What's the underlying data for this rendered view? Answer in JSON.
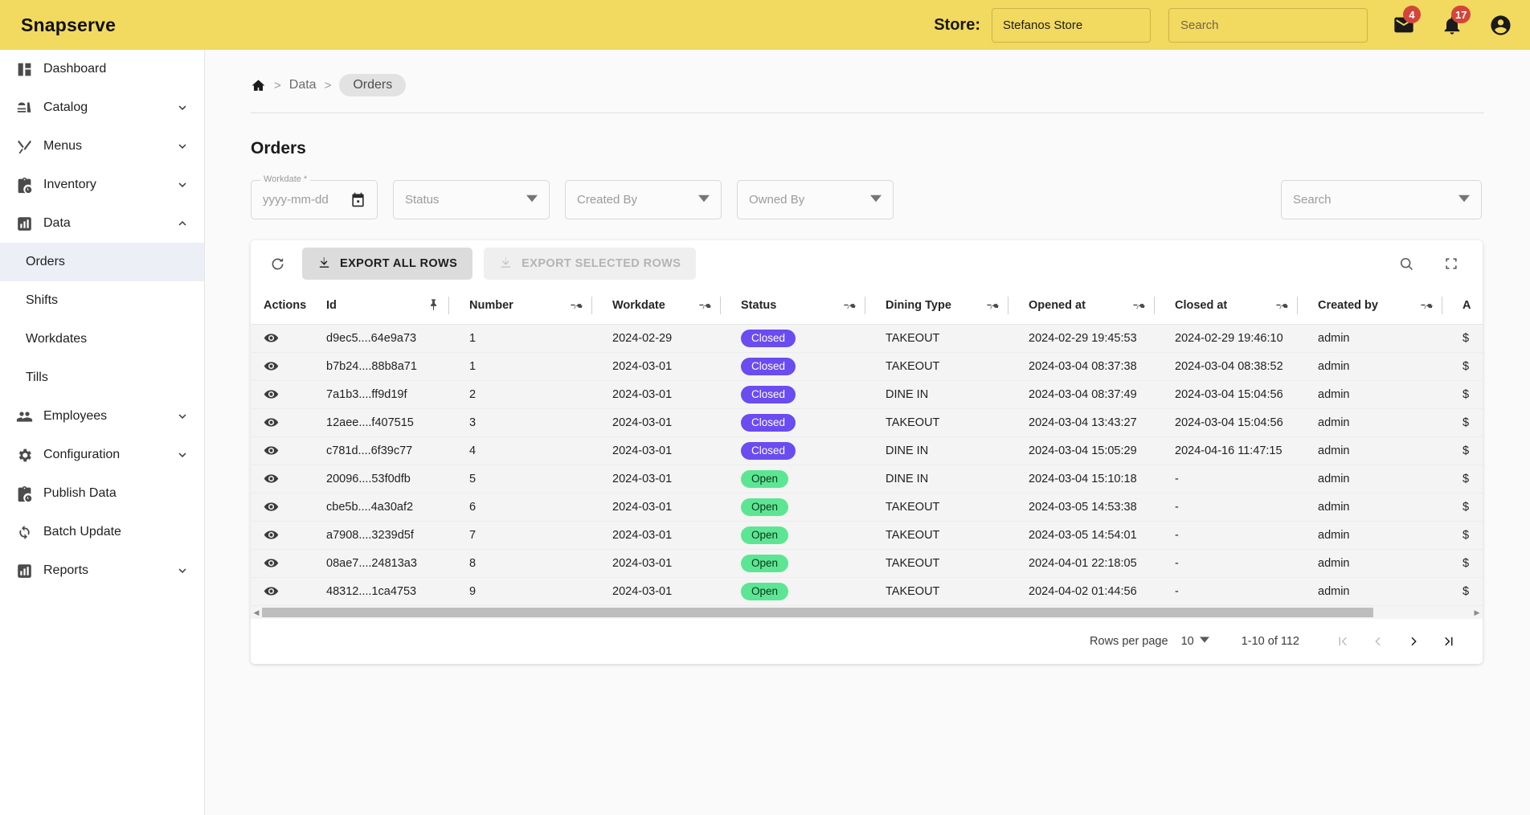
{
  "app": {
    "brand": "Snapserve",
    "header": {
      "store_label": "Store:",
      "store_value": "Stefanos Store",
      "search_placeholder": "Search",
      "mail_badge": "4",
      "bell_badge": "17",
      "accent_color": "#f2d95f"
    }
  },
  "sidebar": {
    "items": [
      {
        "label": "Dashboard",
        "icon": "dashboard-icon",
        "expandable": false
      },
      {
        "label": "Catalog",
        "icon": "catalog-icon",
        "expandable": true
      },
      {
        "label": "Menus",
        "icon": "menus-icon",
        "expandable": true
      },
      {
        "label": "Inventory",
        "icon": "inventory-icon",
        "expandable": true
      },
      {
        "label": "Data",
        "icon": "data-icon",
        "expandable": true,
        "expanded": true
      }
    ],
    "data_children": [
      {
        "label": "Orders",
        "active": true
      },
      {
        "label": "Shifts",
        "active": false
      },
      {
        "label": "Workdates",
        "active": false
      },
      {
        "label": "Tills",
        "active": false
      }
    ],
    "items_after": [
      {
        "label": "Employees",
        "icon": "employees-icon",
        "expandable": true
      },
      {
        "label": "Configuration",
        "icon": "gear-icon",
        "expandable": true
      },
      {
        "label": "Publish Data",
        "icon": "publish-icon",
        "expandable": false
      },
      {
        "label": "Batch Update",
        "icon": "sync-icon",
        "expandable": false
      },
      {
        "label": "Reports",
        "icon": "reports-icon",
        "expandable": true
      }
    ]
  },
  "breadcrumb": {
    "home_icon": "home-icon",
    "items": [
      "Data",
      "Orders"
    ],
    "separator": ">"
  },
  "page": {
    "title": "Orders"
  },
  "filters": {
    "workdate": {
      "legend": "Workdate *",
      "placeholder": "yyyy-mm-dd",
      "icon": "calendar-icon"
    },
    "status": {
      "placeholder": "Status"
    },
    "created_by": {
      "placeholder": "Created By"
    },
    "owned_by": {
      "placeholder": "Owned By"
    },
    "search": {
      "placeholder": "Search"
    }
  },
  "toolbar": {
    "refresh_icon": "refresh-icon",
    "export_all_label": "EXPORT ALL ROWS",
    "export_selected_label": "EXPORT SELECTED ROWS",
    "search_icon": "search-icon",
    "fullscreen_icon": "fullscreen-icon"
  },
  "table": {
    "columns": [
      {
        "label": "Actions",
        "pin": false
      },
      {
        "label": "Id",
        "pin": "pinned"
      },
      {
        "label": "Number",
        "pin": "unpinned"
      },
      {
        "label": "Workdate",
        "pin": "unpinned"
      },
      {
        "label": "Status",
        "pin": "unpinned"
      },
      {
        "label": "Dining Type",
        "pin": "unpinned"
      },
      {
        "label": "Opened at",
        "pin": "unpinned"
      },
      {
        "label": "Closed at",
        "pin": "unpinned"
      },
      {
        "label": "Created by",
        "pin": "unpinned"
      },
      {
        "label": "A",
        "pin": false
      }
    ],
    "rows": [
      {
        "action_icon": "eye-icon",
        "id": "d9ec5....64e9a73",
        "number": "1",
        "workdate": "2024-02-29",
        "status": "Closed",
        "dining_type": "TAKEOUT",
        "opened_at": "2024-02-29 19:45:53",
        "closed_at": "2024-02-29 19:46:10",
        "created_by": "admin",
        "amount": "$"
      },
      {
        "action_icon": "eye-icon",
        "id": "b7b24....88b8a71",
        "number": "1",
        "workdate": "2024-03-01",
        "status": "Closed",
        "dining_type": "TAKEOUT",
        "opened_at": "2024-03-04 08:37:38",
        "closed_at": "2024-03-04 08:38:52",
        "created_by": "admin",
        "amount": "$"
      },
      {
        "action_icon": "eye-icon",
        "id": "7a1b3....ff9d19f",
        "number": "2",
        "workdate": "2024-03-01",
        "status": "Closed",
        "dining_type": "DINE IN",
        "opened_at": "2024-03-04 08:37:49",
        "closed_at": "2024-03-04 15:04:56",
        "created_by": "admin",
        "amount": "$"
      },
      {
        "action_icon": "eye-icon",
        "id": "12aee....f407515",
        "number": "3",
        "workdate": "2024-03-01",
        "status": "Closed",
        "dining_type": "TAKEOUT",
        "opened_at": "2024-03-04 13:43:27",
        "closed_at": "2024-03-04 15:04:56",
        "created_by": "admin",
        "amount": "$"
      },
      {
        "action_icon": "eye-icon",
        "id": "c781d....6f39c77",
        "number": "4",
        "workdate": "2024-03-01",
        "status": "Closed",
        "dining_type": "DINE IN",
        "opened_at": "2024-03-04 15:05:29",
        "closed_at": "2024-04-16 11:47:15",
        "created_by": "admin",
        "amount": "$"
      },
      {
        "action_icon": "eye-icon",
        "id": "20096....53f0dfb",
        "number": "5",
        "workdate": "2024-03-01",
        "status": "Open",
        "dining_type": "DINE IN",
        "opened_at": "2024-03-04 15:10:18",
        "closed_at": "-",
        "created_by": "admin",
        "amount": "$"
      },
      {
        "action_icon": "eye-icon",
        "id": "cbe5b....4a30af2",
        "number": "6",
        "workdate": "2024-03-01",
        "status": "Open",
        "dining_type": "TAKEOUT",
        "opened_at": "2024-03-05 14:53:38",
        "closed_at": "-",
        "created_by": "admin",
        "amount": "$"
      },
      {
        "action_icon": "eye-icon",
        "id": "a7908....3239d5f",
        "number": "7",
        "workdate": "2024-03-01",
        "status": "Open",
        "dining_type": "TAKEOUT",
        "opened_at": "2024-03-05 14:54:01",
        "closed_at": "-",
        "created_by": "admin",
        "amount": "$"
      },
      {
        "action_icon": "eye-icon",
        "id": "08ae7....24813a3",
        "number": "8",
        "workdate": "2024-03-01",
        "status": "Open",
        "dining_type": "TAKEOUT",
        "opened_at": "2024-04-01 22:18:05",
        "closed_at": "-",
        "created_by": "admin",
        "amount": "$"
      },
      {
        "action_icon": "eye-icon",
        "id": "48312....1ca4753",
        "number": "9",
        "workdate": "2024-03-01",
        "status": "Open",
        "dining_type": "TAKEOUT",
        "opened_at": "2024-04-02 01:44:56",
        "closed_at": "-",
        "created_by": "admin",
        "amount": "$"
      }
    ],
    "status_colors": {
      "Closed": "#6a4cf0",
      "Open": "#5ce693"
    }
  },
  "pagination": {
    "rows_per_page_label": "Rows per page",
    "rows_per_page_value": "10",
    "range": "1-10 of 112",
    "first_icon": "first-page-icon",
    "prev_icon": "prev-page-icon",
    "next_icon": "next-page-icon",
    "last_icon": "last-page-icon"
  }
}
